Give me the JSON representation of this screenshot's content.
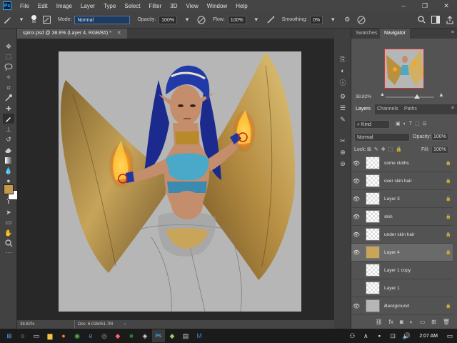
{
  "app": {
    "logo": "Ps"
  },
  "menu": [
    "File",
    "Edit",
    "Image",
    "Layer",
    "Type",
    "Select",
    "Filter",
    "3D",
    "View",
    "Window",
    "Help"
  ],
  "window_controls": {
    "minimize": "–",
    "restore": "❐",
    "close": "✕"
  },
  "options": {
    "brush_size": "90",
    "mode_label": "Mode:",
    "mode_value": "Normal",
    "opacity_label": "Opacity:",
    "opacity_value": "100%",
    "flow_label": "Flow:",
    "flow_value": "100%",
    "smoothing_label": "Smoothing:",
    "smoothing_value": "0%"
  },
  "tools": [
    "move-icon",
    "marquee-icon",
    "lasso-icon",
    "magic-wand-icon",
    "crop-icon",
    "eyedropper-icon",
    "healing-icon",
    "brush-icon",
    "clone-stamp-icon",
    "history-brush-icon",
    "eraser-icon",
    "gradient-icon",
    "blur-icon",
    "dodge-icon",
    "pen-icon",
    "type-icon",
    "path-select-icon",
    "shape-icon",
    "hand-icon",
    "zoom-icon"
  ],
  "colors": {
    "foreground": "#c49a4a",
    "background": "#ffffff",
    "accent": "#31a8ff"
  },
  "document": {
    "tab_title": "spinx.psd @ 38.8% (Layer 4, RGB/8#) *"
  },
  "status": {
    "zoom": "38.82%",
    "doc": "Doc: 6.01M/51.7M"
  },
  "navigator": {
    "tabs": [
      "Swatches",
      "Navigator"
    ],
    "zoom": "38.82%"
  },
  "layers_panel": {
    "tabs": [
      "Layers",
      "Channels",
      "Paths"
    ],
    "kind_label": "Kind",
    "blend_mode": "Normal",
    "opacity_label": "Opacity:",
    "opacity_value": "100%",
    "lock_label": "Lock:",
    "fill_label": "Fill:",
    "fill_value": "100%",
    "layers": [
      {
        "name": "some cloths",
        "visible": true,
        "selected": false
      },
      {
        "name": "over skin hair",
        "visible": true,
        "selected": false
      },
      {
        "name": "Layer 3",
        "visible": true,
        "selected": false
      },
      {
        "name": "skin",
        "visible": true,
        "selected": false
      },
      {
        "name": "under skin hair",
        "visible": true,
        "selected": false
      },
      {
        "name": "Layer 4",
        "visible": true,
        "selected": true
      },
      {
        "name": "Layer 1 copy",
        "visible": false,
        "selected": false
      },
      {
        "name": "Layer 1",
        "visible": false,
        "selected": false
      },
      {
        "name": "Background",
        "visible": true,
        "selected": false
      }
    ]
  },
  "taskbar": {
    "time": "2:07 AM"
  }
}
